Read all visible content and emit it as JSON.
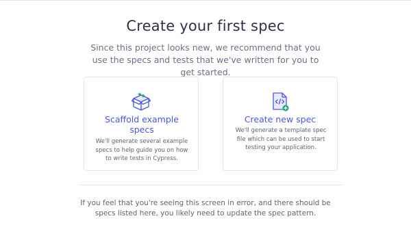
{
  "header": {
    "title": "Create your first spec",
    "subtitle": "Since this project looks new, we recommend that you use the specs and tests that we've written for you to get started."
  },
  "cards": {
    "scaffold": {
      "icon": "box-wand-icon",
      "title": "Scaffold example specs",
      "description": "We'll generate several example specs to help guide you on how to write tests in Cypress."
    },
    "create": {
      "icon": "code-file-add-icon",
      "title": "Create new spec",
      "description": "We'll generate a template spec file which can be used to start testing your application."
    }
  },
  "footer": {
    "text": "If you feel that you're seeing this screen in error, and there should be specs listed here, you likely need to update the spec pattern."
  },
  "colors": {
    "accent": "#4956e3",
    "accent_light": "#a6ade8",
    "success": "#1fa971",
    "title_text": "#2e3247",
    "body_text": "#6b7186",
    "border": "#e4e6ee"
  }
}
